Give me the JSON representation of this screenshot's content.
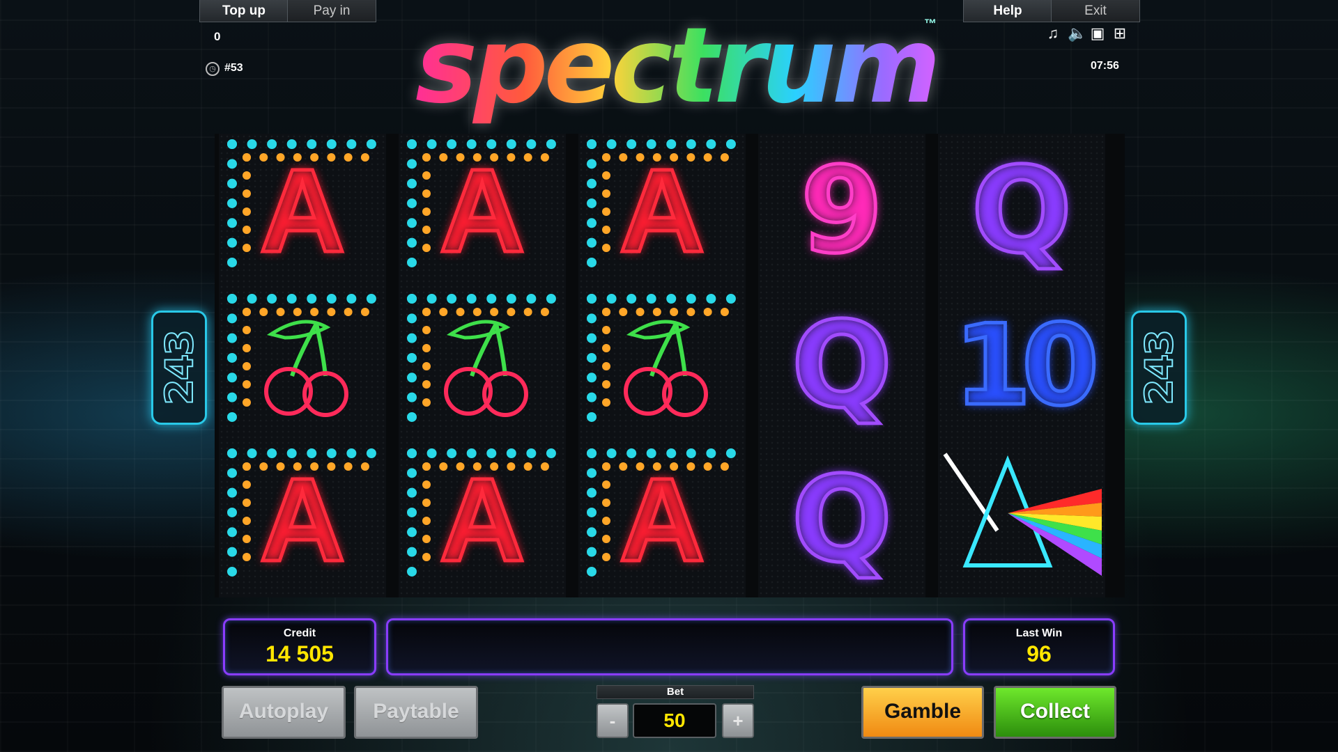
{
  "header": {
    "top_up_label": "Top up",
    "pay_in_label": "Pay in",
    "help_label": "Help",
    "exit_label": "Exit",
    "balance_value": "0",
    "round_id": "#53",
    "clock": "07:56",
    "icons": [
      "music-icon",
      "speaker-icon",
      "screen-icon",
      "grid-icon"
    ]
  },
  "logo": {
    "text": "spectrum",
    "trademark": "™"
  },
  "ways_badge": {
    "left": "243",
    "right": "243"
  },
  "reels": [
    [
      "A",
      "cherry",
      "A"
    ],
    [
      "A",
      "cherry",
      "A"
    ],
    [
      "A",
      "cherry",
      "A"
    ],
    [
      "9",
      "Q",
      "Q"
    ],
    [
      "Q",
      "10",
      "prism"
    ]
  ],
  "footer": {
    "credit_label": "Credit",
    "credit_value": "14 505",
    "last_win_label": "Last Win",
    "last_win_value": "96",
    "autoplay_label": "Autoplay",
    "paytable_label": "Paytable",
    "bet_label": "Bet",
    "bet_value": "50",
    "bet_minus": "-",
    "bet_plus": "+",
    "gamble_label": "Gamble",
    "collect_label": "Collect"
  },
  "colors": {
    "accent_panel": "#8a3cff",
    "value_yellow": "#ffe600",
    "gamble": "#f0a020",
    "collect": "#3ca814"
  }
}
